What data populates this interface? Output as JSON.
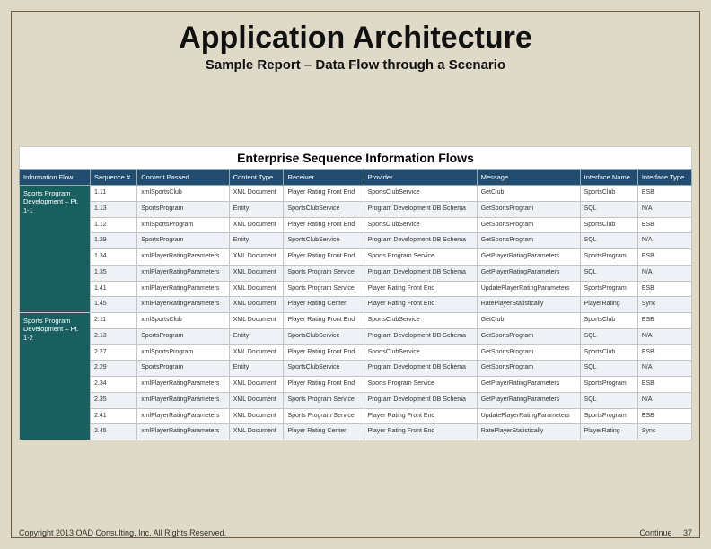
{
  "title": "Application Architecture",
  "subtitle": "Sample Report – Data Flow through a Scenario",
  "table": {
    "title": "Enterprise Sequence Information Flows",
    "columns": [
      "Information Flow",
      "Sequence #",
      "Content Passed",
      "Content Type",
      "Receiver",
      "Provider",
      "Message",
      "Interface Name",
      "Interface Type"
    ],
    "groups": [
      {
        "flow": "Sports Program Development – Pt. 1-1",
        "rows": [
          {
            "seq": "1.11",
            "content": "xmlSportsClub",
            "ctype": "XML Document",
            "receiver": "Player Rating Front End",
            "provider": "SportsClubService",
            "message": "GetClub",
            "iface": "SportsClub",
            "itype": "ESB"
          },
          {
            "seq": "1.13",
            "content": "SportsProgram",
            "ctype": "Entity",
            "receiver": "SportsClubService",
            "provider": "Program Development DB Schema",
            "message": "GetSportsProgram",
            "iface": "SQL",
            "itype": "N/A"
          },
          {
            "seq": "1.12",
            "content": "xmlSportsProgram",
            "ctype": "XML Document",
            "receiver": "Player Rating Front End",
            "provider": "SportsClubService",
            "message": "GetSportsProgram",
            "iface": "SportsClub",
            "itype": "ESB"
          },
          {
            "seq": "1.29",
            "content": "SportsProgram",
            "ctype": "Entity",
            "receiver": "SportsClubService",
            "provider": "Program Development DB Schema",
            "message": "GetSportsProgram",
            "iface": "SQL",
            "itype": "N/A"
          },
          {
            "seq": "1.34",
            "content": "xmlPlayerRatingParameters",
            "ctype": "XML Document",
            "receiver": "Player Rating Front End",
            "provider": "Sports Program Service",
            "message": "GetPlayerRatingParameters",
            "iface": "SportsProgram",
            "itype": "ESB"
          },
          {
            "seq": "1.35",
            "content": "xmlPlayerRatingParameters",
            "ctype": "XML Document",
            "receiver": "Sports Program Service",
            "provider": "Program Development DB Schema",
            "message": "GetPlayerRatingParameters",
            "iface": "SQL",
            "itype": "N/A"
          },
          {
            "seq": "1.41",
            "content": "xmlPlayerRatingParameters",
            "ctype": "XML Document",
            "receiver": "Sports Program Service",
            "provider": "Player Rating Front End",
            "message": "UpdatePlayerRatingParameters",
            "iface": "SportsProgram",
            "itype": "ESB"
          },
          {
            "seq": "1.45",
            "content": "xmlPlayerRatingParameters",
            "ctype": "XML Document",
            "receiver": "Player Rating Center",
            "provider": "Player Rating Front End",
            "message": "RatePlayerStatistically",
            "iface": "PlayerRating",
            "itype": "Sync"
          }
        ]
      },
      {
        "flow": "Sports Program Development – Pt. 1-2",
        "rows": [
          {
            "seq": "2.11",
            "content": "xmlSportsClub",
            "ctype": "XML Document",
            "receiver": "Player Rating Front End",
            "provider": "SportsClubService",
            "message": "GetClub",
            "iface": "SportsClub",
            "itype": "ESB"
          },
          {
            "seq": "2.13",
            "content": "SportsProgram",
            "ctype": "Entity",
            "receiver": "SportsClubService",
            "provider": "Program Development DB Schema",
            "message": "GetSportsProgram",
            "iface": "SQL",
            "itype": "N/A"
          },
          {
            "seq": "2.27",
            "content": "xmlSportsProgram",
            "ctype": "XML Document",
            "receiver": "Player Rating Front End",
            "provider": "SportsClubService",
            "message": "GetSportsProgram",
            "iface": "SportsClub",
            "itype": "ESB"
          },
          {
            "seq": "2.29",
            "content": "SportsProgram",
            "ctype": "Entity",
            "receiver": "SportsClubService",
            "provider": "Program Development DB Schema",
            "message": "GetSportsProgram",
            "iface": "SQL",
            "itype": "N/A"
          },
          {
            "seq": "2.34",
            "content": "xmlPlayerRatingParameters",
            "ctype": "XML Document",
            "receiver": "Player Rating Front End",
            "provider": "Sports Program Service",
            "message": "GetPlayerRatingParameters",
            "iface": "SportsProgram",
            "itype": "ESB"
          },
          {
            "seq": "2.35",
            "content": "xmlPlayerRatingParameters",
            "ctype": "XML Document",
            "receiver": "Sports Program Service",
            "provider": "Program Development DB Schema",
            "message": "GetPlayerRatingParameters",
            "iface": "SQL",
            "itype": "N/A"
          },
          {
            "seq": "2.41",
            "content": "xmlPlayerRatingParameters",
            "ctype": "XML Document",
            "receiver": "Sports Program Service",
            "provider": "Player Rating Front End",
            "message": "UpdatePlayerRatingParameters",
            "iface": "SportsProgram",
            "itype": "ESB"
          },
          {
            "seq": "2.45",
            "content": "xmlPlayerRatingParameters",
            "ctype": "XML Document",
            "receiver": "Player Rating Center",
            "provider": "Player Rating Front End",
            "message": "RatePlayerStatistically",
            "iface": "PlayerRating",
            "itype": "Sync"
          }
        ]
      }
    ]
  },
  "footer": {
    "copyright": "Copyright 2013 OAD Consulting, Inc.  All Rights Reserved.",
    "continue": "Continue",
    "page": "37"
  }
}
